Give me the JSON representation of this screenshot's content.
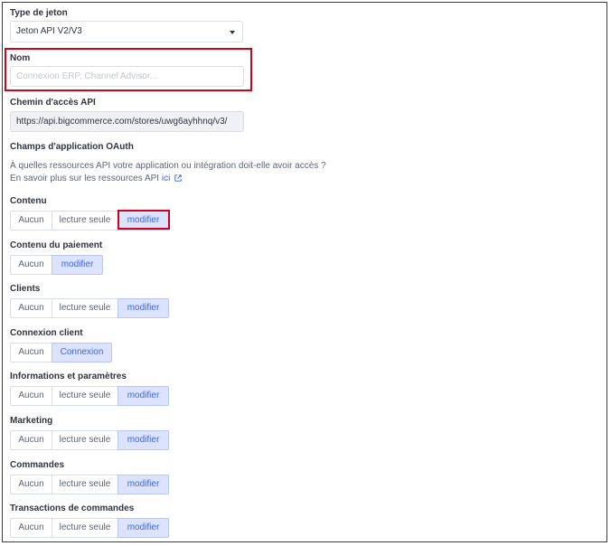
{
  "token_type": {
    "label": "Type de jeton",
    "value": "Jeton API V2/V3"
  },
  "name": {
    "label": "Nom",
    "placeholder": "Connexion ERP, Channel Advisor..."
  },
  "api_path": {
    "label": "Chemin d'accès API",
    "value": "https://api.bigcommerce.com/stores/uwg6ayhhnq/v3/"
  },
  "oauth": {
    "title": "Champs d'application OAuth",
    "question": "À quelles ressources API votre application ou intégration doit-elle avoir accès ?",
    "learn_more": "En savoir plus sur les ressources API",
    "link": "ici",
    "icon": "external-link-icon"
  },
  "scopes": [
    {
      "label": "Contenu",
      "options": [
        "Aucun",
        "lecture seule",
        "modifier"
      ],
      "selected": "modifier"
    },
    {
      "label": "Contenu du paiement",
      "options": [
        "Aucun",
        "modifier"
      ],
      "selected": "modifier"
    },
    {
      "label": "Clients",
      "options": [
        "Aucun",
        "lecture seule",
        "modifier"
      ],
      "selected": "modifier"
    },
    {
      "label": "Connexion client",
      "options": [
        "Aucun",
        "Connexion"
      ],
      "selected": "Connexion"
    },
    {
      "label": "Informations et paramètres",
      "options": [
        "Aucun",
        "lecture seule",
        "modifier"
      ],
      "selected": "modifier"
    },
    {
      "label": "Marketing",
      "options": [
        "Aucun",
        "lecture seule",
        "modifier"
      ],
      "selected": "modifier"
    },
    {
      "label": "Commandes",
      "options": [
        "Aucun",
        "lecture seule",
        "modifier"
      ],
      "selected": "modifier"
    },
    {
      "label": "Transactions de commandes",
      "options": [
        "Aucun",
        "lecture seule",
        "modifier"
      ],
      "selected": "modifier"
    }
  ],
  "colors": {
    "accent": "#3c64f4",
    "selected_bg": "#dbe3fe",
    "highlight": "#d0021b"
  }
}
